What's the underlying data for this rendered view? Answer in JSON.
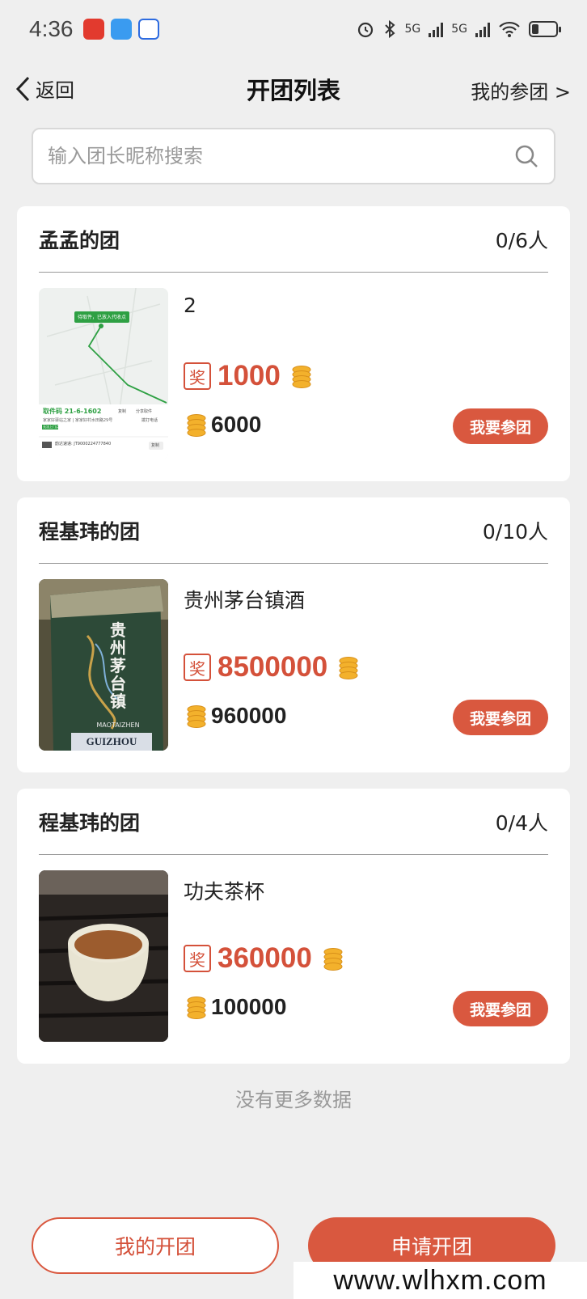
{
  "status": {
    "time": "4:36",
    "net1": "5G",
    "net2": "5G",
    "battery_pct": 0.3
  },
  "header": {
    "back_label": "返回",
    "title": "开团列表",
    "my_join_label": "我的参团 >"
  },
  "search": {
    "placeholder": "输入团长昵称搜索",
    "value": ""
  },
  "groups": [
    {
      "leader": "孟孟的团",
      "count": "0/6人",
      "product": "2",
      "prize_tag": "奖",
      "prize": "1000",
      "cost": "6000",
      "join_label": "我要参团",
      "thumb": "map-screenshot"
    },
    {
      "leader": "程基玮的团",
      "count": "0/10人",
      "product": "贵州茅台镇酒",
      "prize_tag": "奖",
      "prize": "8500000",
      "cost": "960000",
      "join_label": "我要参团",
      "thumb": "liquor-box-photo"
    },
    {
      "leader": "程基玮的团",
      "count": "0/4人",
      "product": "功夫茶杯",
      "prize_tag": "奖",
      "prize": "360000",
      "cost": "100000",
      "join_label": "我要参团",
      "thumb": "tea-cup-photo"
    }
  ],
  "map_thumb": {
    "banner": "待取件，已放入代收点",
    "code": "取件码 21-6-1602",
    "addr": "家家好驿站之家 | 家家好村水田路29号",
    "tag": "无法上门点",
    "tracking": "韵达速递: JT9000224777840",
    "copy": "复制",
    "act1": "复制",
    "act2": "分享取件",
    "act3": "拨打电话"
  },
  "liquor_thumb": {
    "line1": "MAOTAIZHEN",
    "line2": "GUIZHOU",
    "calligraphy": "贵州茅台镇"
  },
  "footer": {
    "no_more": "没有更多数据",
    "my_groups_label": "我的开团",
    "apply_label": "申请开团",
    "watermark": "www.wlhxm.com"
  },
  "colors": {
    "accent": "#d9583f",
    "prize": "#d4513a",
    "background": "#efefef"
  }
}
